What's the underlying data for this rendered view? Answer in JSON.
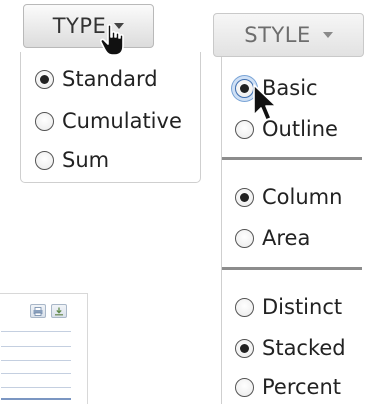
{
  "type_dropdown": {
    "label": "TYPE",
    "options": [
      {
        "label": "Standard",
        "selected": true
      },
      {
        "label": "Cumulative",
        "selected": false
      },
      {
        "label": "Sum",
        "selected": false
      }
    ]
  },
  "style_dropdown": {
    "label": "STYLE",
    "groups": [
      [
        {
          "label": "Basic",
          "selected": true,
          "focused": true
        },
        {
          "label": "Outline",
          "selected": false
        }
      ],
      [
        {
          "label": "Column",
          "selected": true
        },
        {
          "label": "Area",
          "selected": false
        }
      ],
      [
        {
          "label": "Distinct",
          "selected": false
        },
        {
          "label": "Stacked",
          "selected": true
        },
        {
          "label": "Percent",
          "selected": false
        }
      ]
    ]
  },
  "background_panel": {
    "icons": [
      "print-icon",
      "download-icon"
    ]
  },
  "cursors": [
    "hand-pointer-icon",
    "arrow-pointer-icon"
  ],
  "colors": {
    "button_text": "#333333",
    "radio_focus": "#7aa4d6",
    "divider": "#8c8c8c"
  }
}
